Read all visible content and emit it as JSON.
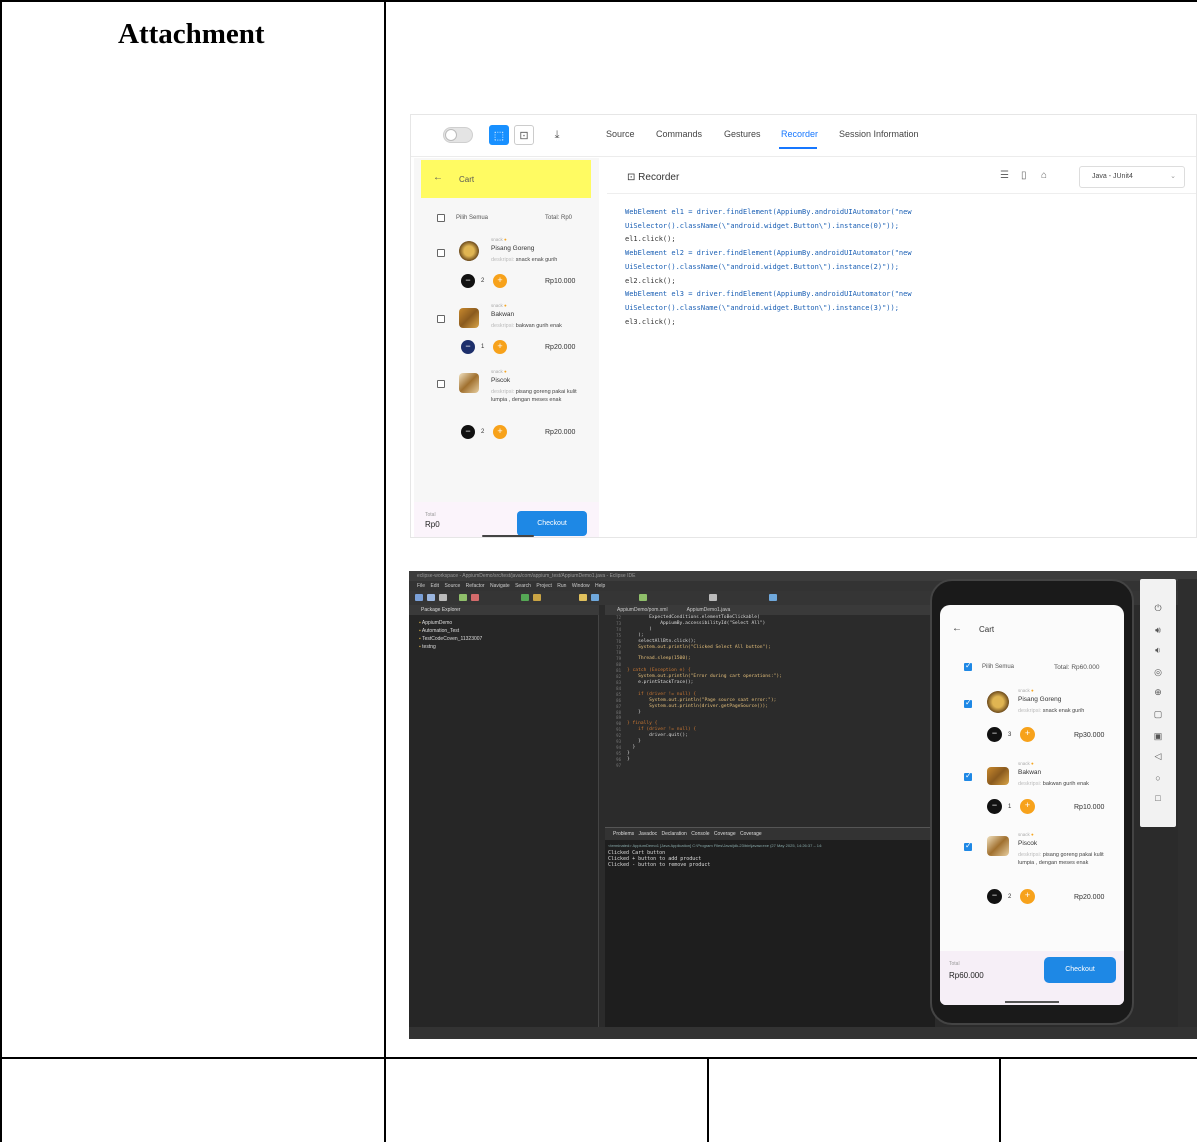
{
  "document": {
    "attachment_heading": "Attachment"
  },
  "inspector": {
    "tabs": [
      "Source",
      "Commands",
      "Gestures",
      "Recorder",
      "Session Information"
    ],
    "active_tab": "Recorder",
    "recorder_title": "Recorder",
    "language_select": "Java - JUnit4",
    "code_lines": [
      "WebElement el1 = driver.findElement(AppiumBy.androidUIAutomator(\"new",
      "UiSelector().className(\\\"android.widget.Button\\\").instance(0)\"));",
      "el1.click();",
      "WebElement el2 = driver.findElement(AppiumBy.androidUIAutomator(\"new",
      "UiSelector().className(\\\"android.widget.Button\\\").instance(2)\"));",
      "el2.click();",
      "WebElement el3 = driver.findElement(AppiumBy.androidUIAutomator(\"new",
      "UiSelector().className(\\\"android.widget.Button\\\").instance(3)\"));",
      "el3.click();"
    ],
    "app": {
      "cart_title": "Cart",
      "select_all": "Pilih Semua",
      "total_header": "Total: Rp0",
      "items": [
        {
          "category": "snack",
          "name": "Pisang Goreng",
          "desc_label": "deskripsi:",
          "desc": "snack enak gurih",
          "qty": "2",
          "price": "Rp10.000"
        },
        {
          "category": "snack",
          "name": "Bakwan",
          "desc_label": "deskripsi:",
          "desc": "bakwan gurih enak",
          "qty": "1",
          "price": "Rp20.000"
        },
        {
          "category": "snack",
          "name": "Piscok",
          "desc_label": "deskripsi:",
          "desc": "pisang goreng pakai kulit lumpia , dengan meses enak",
          "qty": "2",
          "price": "Rp20.000"
        }
      ],
      "footer_label": "Total",
      "footer_total": "Rp0",
      "checkout": "Checkout"
    }
  },
  "eclipse": {
    "window_title": "eclipse-workspace - AppiumDemo/src/test/java/com/appium_test/AppiumDemo1.java - Eclipse IDE",
    "menu": "File Edit Source Refactor Navigate Search Project Run Window Help",
    "explorer_tab": "Package Explorer",
    "explorer_items": [
      "AppiumDemo",
      "Automation_Test",
      "TestCodeCoven_11323007",
      "testng"
    ],
    "editor_tabs": "AppiumDemo/pom.xml AppiumDemo1.java",
    "line_numbers": "72\n73\n74\n75\n76\n77\n78\n79\n80\n81\n82\n83\n84\n85\n86\n87\n88\n89\n90\n91\n92\n93\n94\n95\n96\n97",
    "code_lines": [
      "        ExpectedConditions.elementToBeClickable(",
      "            AppiumBy.accessibilityId(\"Select All\")",
      "        )",
      "    );",
      "    selectAllBtn.click();",
      "    System.out.println(\"Clicked Select All button\");",
      "",
      "    Thread.sleep(1500);",
      "",
      "} catch (Exception e) {",
      "    System.out.println(\"Error during cart operations:\");",
      "    e.printStackTrace();",
      "",
      "    if (driver != null) {",
      "        System.out.println(\"Page source saat error:\");",
      "        System.out.println(driver.getPageSource());",
      "    }",
      "",
      "} finally {",
      "    if (driver != null) {",
      "        driver.quit();",
      "    }",
      "  }",
      "}",
      "}"
    ],
    "console_tabs": "Problems Javadoc Declaration Console Coverage Coverage",
    "console_terminated": "<terminated> AppiumDemo1 [Java Application] C:\\Program Files\\Java\\jdk-23\\bin\\javaw.exe (27 May 2025, 14:26:37 – 14:",
    "console_output": [
      "Clicked Cart button",
      "Clicked + button to add product",
      "Clicked - button to remove product"
    ]
  },
  "emulator": {
    "cart_title": "Cart",
    "select_all": "Pilih Semua",
    "total_header": "Total: Rp60.000",
    "items": [
      {
        "category": "snack",
        "name": "Pisang Goreng",
        "desc_label": "deskripsi:",
        "desc": "snack enak gurih",
        "qty": "3",
        "price": "Rp30.000"
      },
      {
        "category": "snack",
        "name": "Bakwan",
        "desc_label": "deskripsi:",
        "desc": "bakwan gurih enak",
        "qty": "1",
        "price": "Rp10.000"
      },
      {
        "category": "snack",
        "name": "Piscok",
        "desc_label": "deskripsi:",
        "desc": "pisang goreng pakai kulit lumpia , dengan meses enak",
        "qty": "2",
        "price": "Rp20.000"
      }
    ],
    "footer_label": "Total",
    "footer_total": "Rp60.000",
    "checkout": "Checkout"
  },
  "colors": {
    "accent_blue": "#1e88e5",
    "highlight_yellow": "#fffb62",
    "plus_orange": "#f7a21b"
  }
}
